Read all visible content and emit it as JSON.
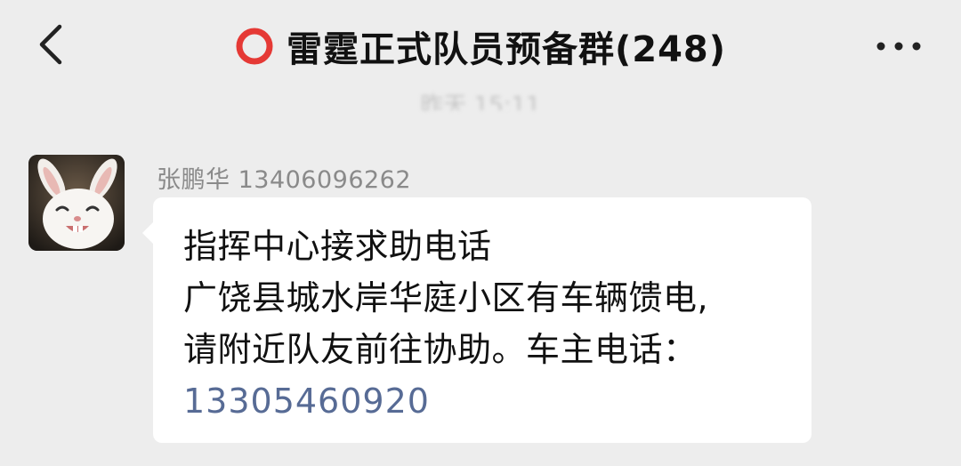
{
  "header": {
    "title": "雷霆正式队员预备群(248)",
    "back_icon": "chevron-left-icon",
    "more_icon": "more-horizontal-icon",
    "title_mark_color": "#e53935"
  },
  "timestamp": "昨天 15:11",
  "message": {
    "sender": "张鹏华 13406096262",
    "lines": [
      "指挥中心接求助电话",
      "广饶县城水岸华庭小区有车辆馈电,",
      "请附近队友前往协助。车主电话："
    ],
    "phone": "13305460920",
    "phone_color": "#576b95"
  }
}
